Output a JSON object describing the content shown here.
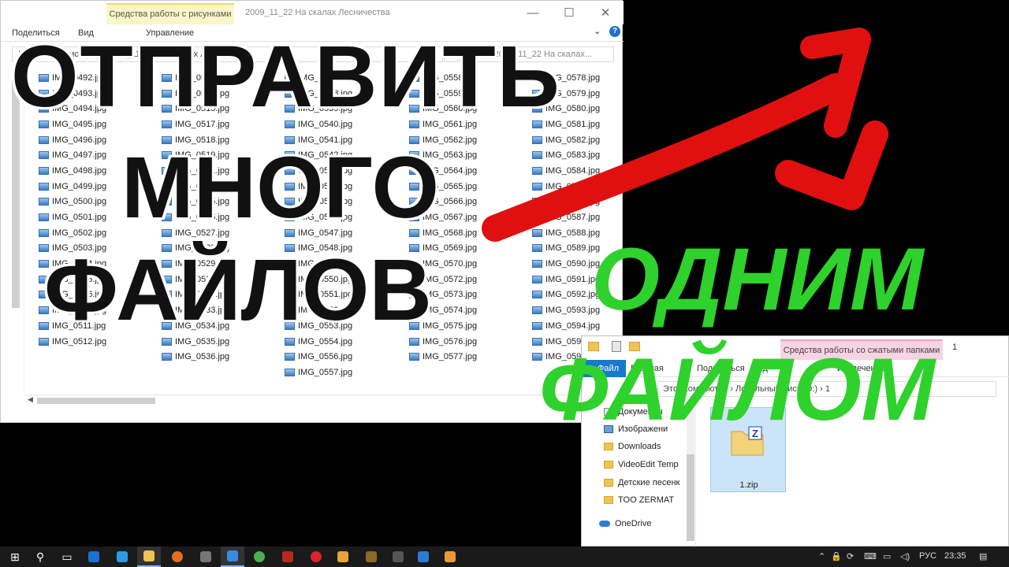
{
  "window1": {
    "context_tab": "Средства работы с рисунками",
    "title": "2009_11_22 На скалах Лесничества",
    "ribbon": {
      "share": "Поделиться",
      "view": "Вид",
      "manage": "Управление"
    },
    "address": "Локальный диск (D:) › 2009_11_22 На скалах Лесничества",
    "search_placeholder": "Поиск: 2009_11_22 На скалах...",
    "files_col1": [
      "IMG_0492.jpg",
      "IMG_0493.jpg",
      "IMG_0494.jpg",
      "IMG_0495.jpg",
      "IMG_0496.jpg",
      "IMG_0497.jpg",
      "IMG_0498.jpg",
      "IMG_0499.jpg",
      "IMG_0500.jpg",
      "IMG_0501.jpg",
      "IMG_0502.jpg",
      "IMG_0503.jpg",
      "IMG_0504.jpg",
      "IMG_0505.jpg",
      "IMG_0506.jpg",
      "IMG_0509.jpg",
      "IMG_0511.jpg",
      "IMG_0512.jpg"
    ],
    "files_col2": [
      "IMG_0513.jpg",
      "IMG_0514.jpg",
      "IMG_0515.jpg",
      "IMG_0517.jpg",
      "IMG_0518.jpg",
      "IMG_0519.jpg",
      "IMG_0521.jpg",
      "IMG_0522.jpg",
      "IMG_0525.jpg",
      "IMG_0526.jpg",
      "IMG_0527.jpg",
      "IMG_0528.jpg",
      "IMG_0529.jpg",
      "IMG_0530.jpg",
      "IMG_0531.jpg",
      "IMG_0533.jpg",
      "IMG_0534.jpg",
      "IMG_0535.jpg",
      "IMG_0536.jpg"
    ],
    "files_col3": [
      "IMG_0537.jpg",
      "IMG_0538.jpg",
      "IMG_0539.jpg",
      "IMG_0540.jpg",
      "IMG_0541.jpg",
      "IMG_0542.jpg",
      "IMG_0543.jpg",
      "IMG_0544.jpg",
      "IMG_0545.jpg",
      "IMG_0546.jpg",
      "IMG_0547.jpg",
      "IMG_0548.jpg",
      "IMG_0549.jpg",
      "IMG_0550.jpg",
      "IMG_0551.jpg",
      "IMG_0552.jpg",
      "IMG_0553.jpg",
      "IMG_0554.jpg",
      "IMG_0556.jpg",
      "IMG_0557.jpg"
    ],
    "files_col4": [
      "IMG_0558.jpg",
      "IMG_0559.jpg",
      "IMG_0560.jpg",
      "IMG_0561.jpg",
      "IMG_0562.jpg",
      "IMG_0563.jpg",
      "IMG_0564.jpg",
      "IMG_0565.jpg",
      "IMG_0566.jpg",
      "IMG_0567.jpg",
      "IMG_0568.jpg",
      "IMG_0569.jpg",
      "IMG_0570.jpg",
      "IMG_0572.jpg",
      "IMG_0573.jpg",
      "IMG_0574.jpg",
      "IMG_0575.jpg",
      "IMG_0576.jpg",
      "IMG_0577.jpg"
    ],
    "files_col5": [
      "IMG_0578.jpg",
      "IMG_0579.jpg",
      "IMG_0580.jpg",
      "IMG_0581.jpg",
      "IMG_0582.jpg",
      "IMG_0583.jpg",
      "IMG_0584.jpg",
      "IMG_0585.jpg",
      "IMG_0586.jpg",
      "IMG_0587.jpg",
      "IMG_0588.jpg",
      "IMG_0589.jpg",
      "IMG_0590.jpg",
      "IMG_0591.jpg",
      "IMG_0592.jpg",
      "IMG_0593.jpg",
      "IMG_0594.jpg",
      "IMG_0595.jpg",
      "IMG_0596.jpg"
    ]
  },
  "window2": {
    "context_tab": "Средства работы со сжатыми папками",
    "title": "1",
    "ribbon": {
      "file": "Файл",
      "home": "Главная",
      "share": "Поделиться",
      "view": "Вид",
      "extract": "Извлечение"
    },
    "address": "Этот компьютер › Локальный диск (D:) › 1",
    "nav": [
      "Документы",
      "Изображени",
      "Downloads",
      "VideoEdit Temp",
      "Детские песенк",
      "TOO ZERMAT",
      "OneDrive"
    ],
    "zip_name": "1.zip"
  },
  "overlay": {
    "line1": "ОТПРАВИТЬ",
    "line2": "МНОГО",
    "line3": "ФАЙЛОВ",
    "line4": "ОДНИМ",
    "line5": "ФАЙЛОМ"
  },
  "taskbar": {
    "lang": "РУС",
    "time": "23:35"
  },
  "colors": {
    "arrow": "#e01010",
    "green_text": "#2fd12c",
    "taskbar": "#1a1a1a"
  }
}
